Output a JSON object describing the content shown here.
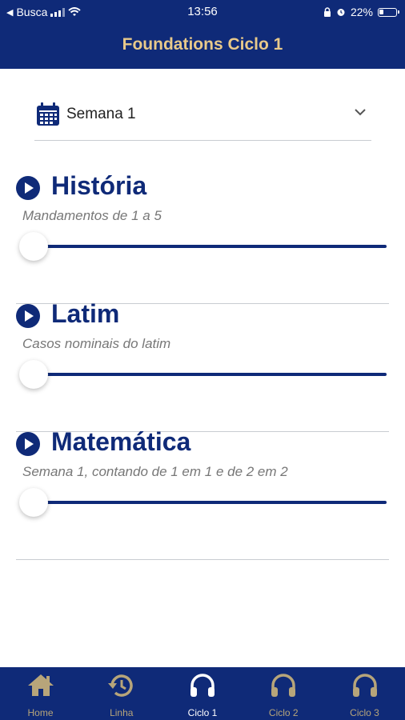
{
  "status_bar": {
    "carrier": "Busca",
    "time": "13:56",
    "battery": "22%"
  },
  "header": {
    "title": "Foundations Ciclo 1"
  },
  "week_selector": {
    "label": "Semana 1"
  },
  "sections": [
    {
      "title": "História",
      "subtitle": "Mandamentos de 1 a 5",
      "progress": 0
    },
    {
      "title": "Latim",
      "subtitle": "Casos nominais do latim",
      "progress": 0
    },
    {
      "title": "Matemática",
      "subtitle": "Semana 1, contando de 1 em 1 e de 2 em 2",
      "progress": 0
    }
  ],
  "tabs": [
    {
      "label": "Home",
      "icon": "home-icon",
      "active": false
    },
    {
      "label": "Linha",
      "icon": "history-icon",
      "active": false
    },
    {
      "label": "Ciclo 1",
      "icon": "headphones-icon",
      "active": true
    },
    {
      "label": "Ciclo 2",
      "icon": "headphones-icon",
      "active": false
    },
    {
      "label": "Ciclo 3",
      "icon": "headphones-icon",
      "active": false
    }
  ],
  "colors": {
    "primary": "#0f2a78",
    "accent": "#e8c98a",
    "tab_inactive": "#b7a57a",
    "tab_active": "#ffffff"
  }
}
